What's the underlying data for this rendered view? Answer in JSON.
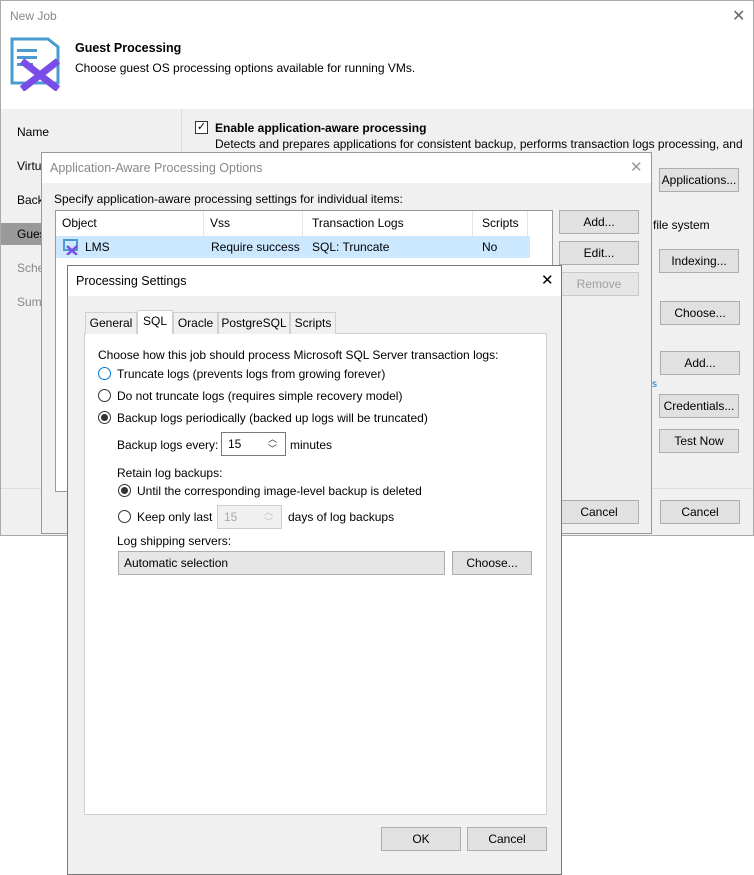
{
  "window": {
    "title": "New Job",
    "header_title": "Guest Processing",
    "header_subtitle": "Choose guest OS processing options available for running VMs."
  },
  "nav": {
    "items": [
      {
        "label": "Name"
      },
      {
        "label": "Virtu"
      },
      {
        "label": "Back"
      },
      {
        "label": "Gues",
        "selected": true
      },
      {
        "label": "Sche"
      },
      {
        "label": "Summ"
      }
    ]
  },
  "main": {
    "enable_label": "Enable application-aware processing",
    "enable_checked": true,
    "enable_desc": "Detects and prepares applications for consistent backup, performs transaction logs processing, and",
    "file_system_text": "file system",
    "link_fragment": "s",
    "buttons": {
      "applications": "Applications...",
      "indexing": "Indexing...",
      "choose": "Choose...",
      "add": "Add...",
      "credentials": "Credentials...",
      "test_now": "Test Now",
      "cancel": "Cancel"
    }
  },
  "app_dialog": {
    "title": "Application-Aware Processing Options",
    "instruction": "Specify application-aware processing settings for individual items:",
    "columns": [
      "Object",
      "Vss",
      "Transaction Logs",
      "Scripts"
    ],
    "rows": [
      {
        "object": "LMS",
        "vss": "Require success",
        "logs": "SQL: Truncate",
        "scripts": "No",
        "selected": true
      }
    ],
    "buttons": {
      "add": "Add...",
      "edit": "Edit...",
      "remove": "Remove",
      "cancel": "Cancel"
    }
  },
  "proc_dialog": {
    "title": "Processing Settings",
    "tabs": [
      "General",
      "SQL",
      "Oracle",
      "PostgreSQL",
      "Scripts"
    ],
    "active_tab": "SQL",
    "intro": "Choose how this job should process Microsoft SQL Server transaction logs:",
    "options": [
      "Truncate logs (prevents logs from growing forever)",
      "Do not truncate logs (requires simple recovery model)",
      "Backup logs periodically (backed up logs will be truncated)"
    ],
    "selected_option": 2,
    "backup_every_label": "Backup logs every:",
    "backup_every_value": "15",
    "minutes_label": "minutes",
    "retain_label": "Retain log backups:",
    "retain_options": [
      "Until the corresponding image-level backup is deleted",
      "Keep only last"
    ],
    "retain_selected": 0,
    "keep_days_value": "15",
    "days_label": "days of log backups",
    "log_shipping_label": "Log shipping servers:",
    "log_shipping_value": "Automatic selection",
    "choose_button": "Choose...",
    "ok_button": "OK",
    "cancel_button": "Cancel"
  },
  "colors": {
    "accent": "#0078d7",
    "selection": "#cce8ff",
    "brand_purple": "#7b4de8",
    "brand_blue": "#4a9bd1"
  }
}
